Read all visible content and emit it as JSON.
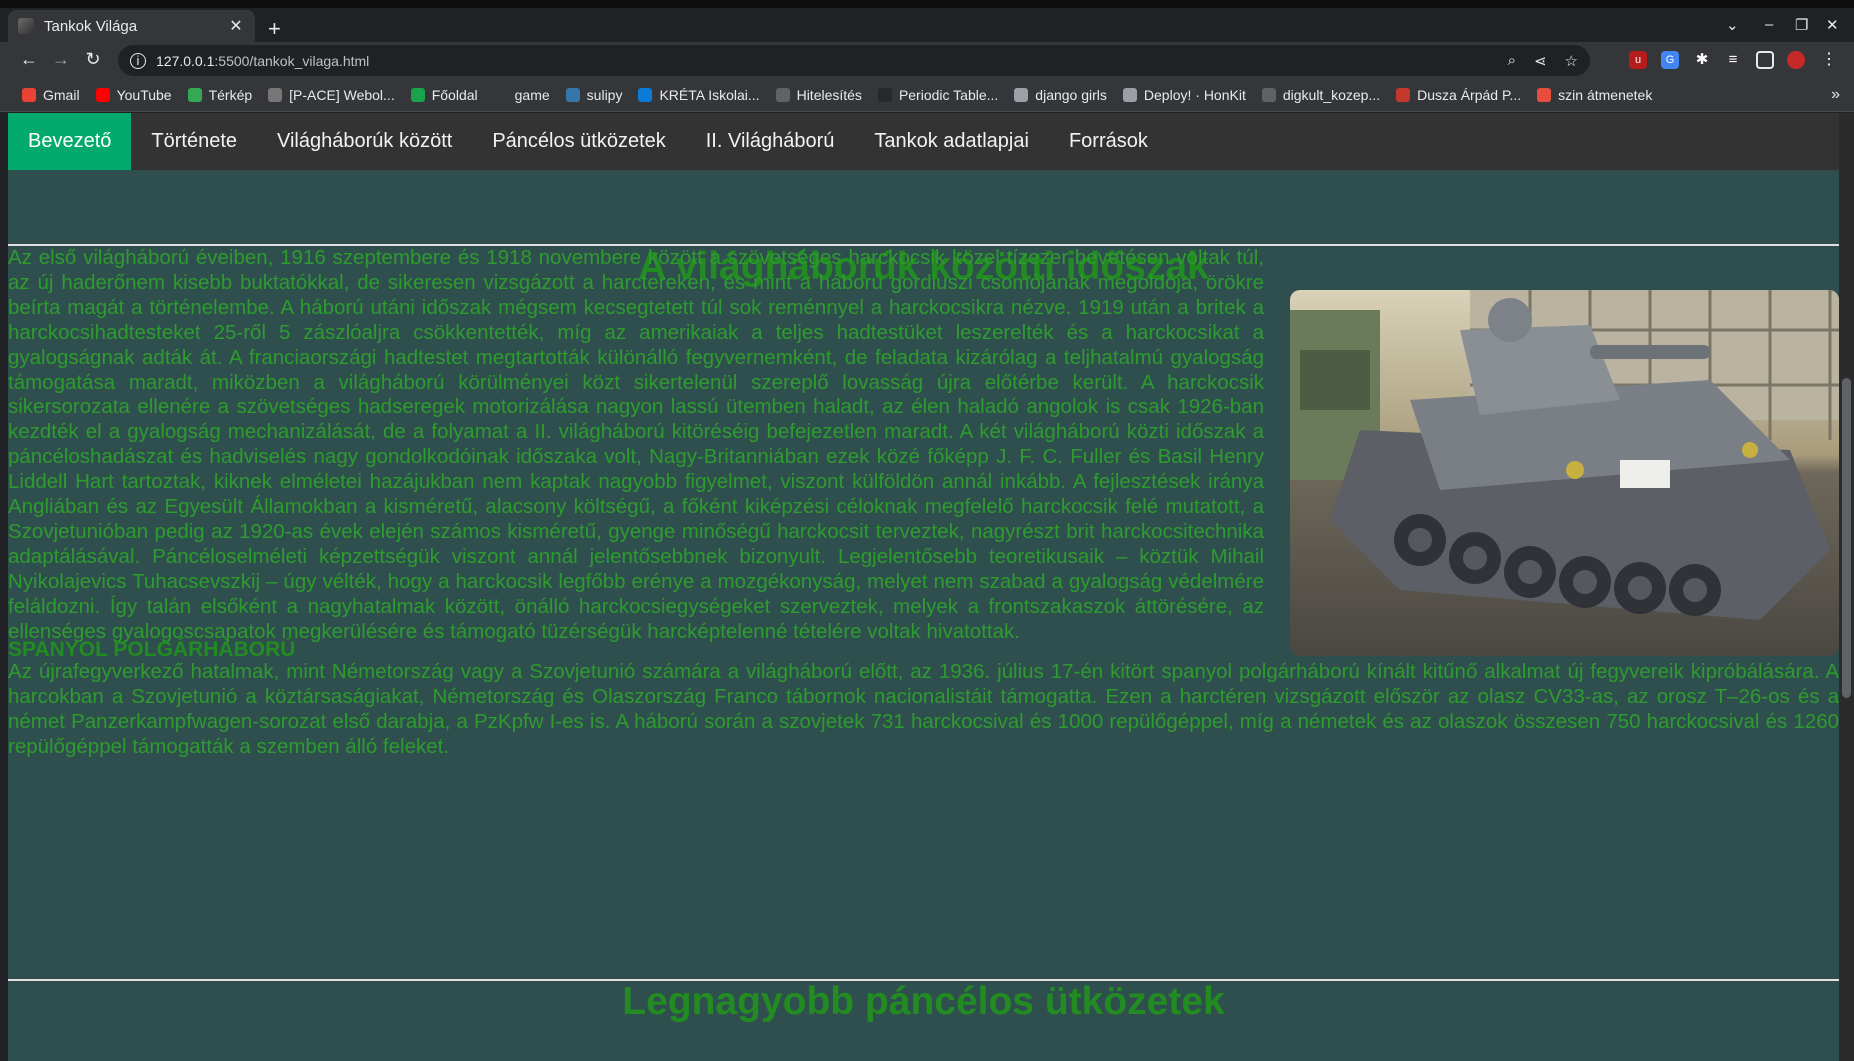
{
  "browser": {
    "tab_title": "Tankok Világa",
    "url_host": "127.0.0.1",
    "url_rest": ":5500/tankok_vilaga.html",
    "bookmarks": [
      {
        "label": "Gmail",
        "icon": "gmail-icon",
        "color": "#ea4335"
      },
      {
        "label": "YouTube",
        "icon": "youtube-icon",
        "color": "#ff0000"
      },
      {
        "label": "Térkép",
        "icon": "maps-icon",
        "color": "#34a853"
      },
      {
        "label": "[P-ACE] Webol...",
        "icon": "page-icon",
        "color": "#777777"
      },
      {
        "label": "Főoldal",
        "icon": "d-icon",
        "color": "#1aa34a"
      },
      {
        "label": "game",
        "icon": "blank-icon",
        "color": "#35363a"
      },
      {
        "label": "sulipy",
        "icon": "python-icon",
        "color": "#3776ab"
      },
      {
        "label": "KRÉTA Iskolai...",
        "icon": "kreta-icon",
        "color": "#0a7bd6"
      },
      {
        "label": "Hitelesítés",
        "icon": "globe-icon",
        "color": "#5f6368"
      },
      {
        "label": "Periodic Table...",
        "icon": "github-icon",
        "color": "#24292e"
      },
      {
        "label": "django girls",
        "icon": "folder-icon",
        "color": "#9aa0a6"
      },
      {
        "label": "Deploy! · HonKit",
        "icon": "book-icon",
        "color": "#9aa0a6"
      },
      {
        "label": "digkult_kozep...",
        "icon": "globe-icon",
        "color": "#5f6368"
      },
      {
        "label": "Dusza Árpád P...",
        "icon": "page-icon",
        "color": "#c0392b"
      },
      {
        "label": "szin átmenetek",
        "icon": "star-icon",
        "color": "#e74c3c"
      }
    ]
  },
  "site": {
    "nav": [
      "Bevezető",
      "Története",
      "Világháborúk között",
      "Páncélos ütközetek",
      "II. Világháború",
      "Tankok adatlapjai",
      "Források"
    ],
    "active_nav": "Bevezető",
    "section_title": "A világháborúk közötti időszak",
    "intro_paragraph": "Az első világháború éveiben, 1916 szeptembere és 1918 novembere között a szövetséges harckocsik közel tízezer bevetésen voltak túl, az új haderőnem kisebb buktatókkal, de sikeresen vizsgázott a harctereken, és mint a háború gordiuszi csomójának megoldója, örökre beírta magát a történelembe. A háború utáni időszak mégsem kecsegtetett túl sok reménnyel a harckocsikra nézve. 1919 után a britek a harckocsihadtesteket 25-ről 5 zászlóaljra csökkentették, míg az amerikaiak a teljes hadtestüket leszerelték és a harckocsikat a gyalogságnak adták át. A franciaországi hadtestet megtartották különálló fegyvernemként, de feladata kizárólag a teljhatalmú gyalogság támogatása maradt, miközben a világháború körülményei közt sikertelenül szereplő lovasság újra előtérbe került. A harckocsik sikersorozata ellenére a szövetséges hadseregek motorizálása nagyon lassú ütemben haladt, az élen haladó angolok is csak 1926-ban kezdték el a gyalogság mechanizálását, de a folyamat a II. világháború kitöréséig befejezetlen maradt. A két világháború közti időszak a páncéloshadászat és hadviselés nagy gondolkodóinak időszaka volt, Nagy-Britanniában ezek közé főképp J. F. C. Fuller és Basil Henry Liddell Hart tartoztak, kiknek elméletei hazájukban nem kaptak nagyobb figyelmet, viszont külföldön annál inkább. A fejlesztések iránya Angliában és az Egyesült Államokban a kisméretű, alacsony költségű, a főként kiképzési céloknak megfelelő harckocsik felé mutatott, a Szovjetunióban pedig az 1920-as évek elején számos kisméretű, gyenge minőségű harckocsit terveztek, nagyrészt brit harckocsitechnika adaptálásával. Páncéloselméleti képzettségük viszont annál jelentősebbnek bizonyult. Legjelentősebb teoretikusaik – köztük Mihail Nyikolajevics Tuhacsevszkij – úgy vélték, hogy a harckocsik legfőbb erénye a mozgékonyság, melyet nem szabad a gyalogság védelmére feláldozni. Így talán elsőként a nagyhatalmak között, önálló harckocsiegységeket szerveztek, melyek a frontszakaszok áttörésére, az ellenséges gyalogoscsapatok megkerülésére és támogató tüzérségük harcképtelenné tételére voltak hivatottak.",
    "subsection_title": "SPANYOL POLGÁRHÁBORÚ",
    "subsection_paragraph": "Az újrafegyverkező hatalmak, mint Németország vagy a Szovjetunió számára a világháború előtt, az 1936. július 17-én kitört spanyol polgárháború kínált kitűnő alkalmat új fegyvereik kipróbálására. A harcokban a Szovjetunió a köztársaságiakat, Németország és Olaszország Franco tábornok nacionalistáit támogatta. Ezen a harctéren vizsgázott először az olasz CV33-as, az orosz T–26-os és a német Panzerkampfwagen-sorozat első darabja, a PzKpfw I-es is. A háború során a szovjetek 731 harckocsival és 1000 repülőgéppel, míg a németek és az olaszok összesen 750 harckocsival és 1260 repülőgéppel támogatták a szemben álló feleket.",
    "next_section_title": "Legnagyobb páncélos ütközetek"
  },
  "colors": {
    "page_bg": "#2f4f4f",
    "nav_bg": "#333333",
    "nav_active": "#04aa6d",
    "heading_green": "#228b22",
    "text_green": "#2e9b2e"
  }
}
